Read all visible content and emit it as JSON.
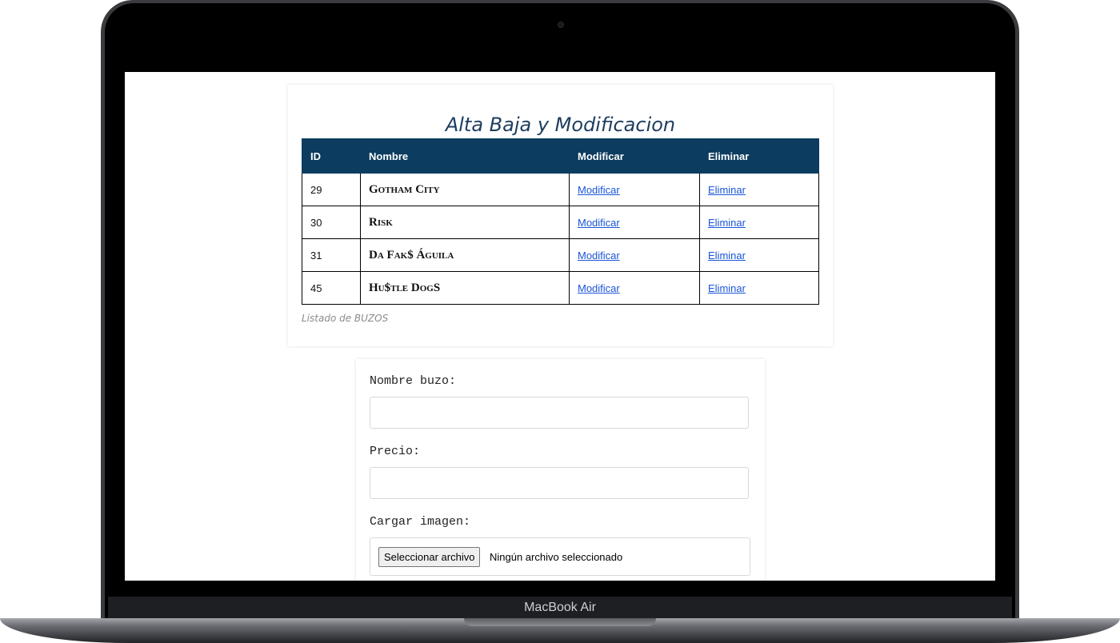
{
  "device": {
    "model_label": "MacBook Air"
  },
  "page": {
    "title": "Alta Baja y Modificacion",
    "table": {
      "headers": [
        "ID",
        "Nombre",
        "Modificar",
        "Eliminar"
      ],
      "rows": [
        {
          "id": "29",
          "nombre": "Gotham City",
          "modificar": "Modificar",
          "eliminar": "Eliminar"
        },
        {
          "id": "30",
          "nombre": "Risk",
          "modificar": "Modificar",
          "eliminar": "Eliminar"
        },
        {
          "id": "31",
          "nombre": "Da Fak$ Águila",
          "modificar": "Modificar",
          "eliminar": "Eliminar"
        },
        {
          "id": "45",
          "nombre": "Hu$tle DogS",
          "modificar": "Modificar",
          "eliminar": "Eliminar"
        }
      ],
      "caption": "Listado de BUZOS"
    },
    "form": {
      "nombre_label": "Nombre buzo:",
      "nombre_value": "",
      "precio_label": "Precio:",
      "precio_value": "",
      "imagen_label": "Cargar imagen:",
      "file_button_label": "Seleccionar archivo",
      "file_status": "Ningún archivo seleccionado"
    }
  },
  "colors": {
    "table_header_bg": "#0c3c5f",
    "title_color": "#1c3d5e",
    "link_color": "#1a55d6"
  }
}
